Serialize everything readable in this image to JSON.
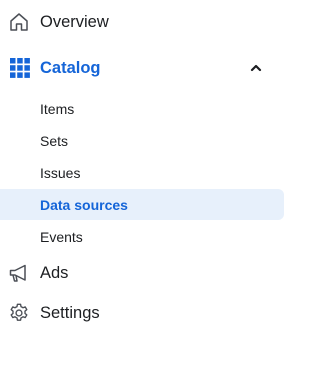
{
  "nav": {
    "overview": {
      "label": "Overview",
      "icon": "home-icon"
    },
    "catalog": {
      "label": "Catalog",
      "icon": "grid-icon",
      "expanded": true,
      "accent": "#1565d8",
      "items": [
        {
          "label": "Items",
          "active": false
        },
        {
          "label": "Sets",
          "active": false
        },
        {
          "label": "Issues",
          "active": false
        },
        {
          "label": "Data sources",
          "active": true
        },
        {
          "label": "Events",
          "active": false
        }
      ]
    },
    "ads": {
      "label": "Ads",
      "icon": "megaphone-icon"
    },
    "settings": {
      "label": "Settings",
      "icon": "gear-icon"
    }
  },
  "colors": {
    "text": "#1c1e21",
    "accent": "#1565d8",
    "active_bg": "#e7f0fb",
    "icon": "#4b4f56"
  }
}
